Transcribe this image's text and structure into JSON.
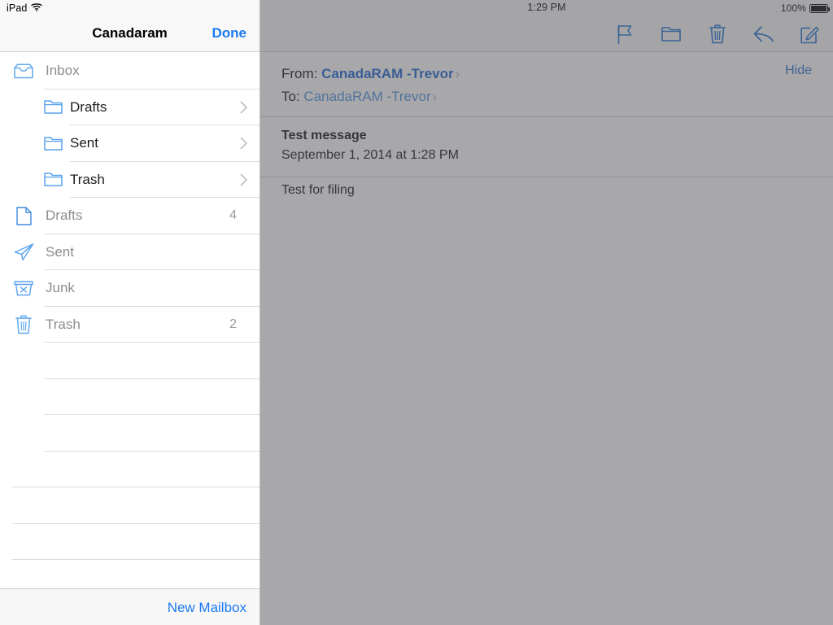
{
  "status_bar": {
    "device": "iPad",
    "wifi_icon": "wifi-icon",
    "time": "1:29 PM",
    "battery_percent": "100%",
    "battery_icon": "battery-full-icon"
  },
  "sidebar": {
    "title": "Canadaram",
    "done_label": "Done",
    "new_mailbox_label": "New Mailbox",
    "rows": [
      {
        "label": "Inbox",
        "icon": "inbox-tray-icon",
        "level": 0,
        "count": "",
        "chevron": false,
        "dim": true
      },
      {
        "label": "Drafts",
        "icon": "folder-icon",
        "level": 1,
        "count": "",
        "chevron": true,
        "dim": false
      },
      {
        "label": "Sent",
        "icon": "folder-icon",
        "level": 1,
        "count": "",
        "chevron": true,
        "dim": false
      },
      {
        "label": "Trash",
        "icon": "folder-icon",
        "level": 1,
        "count": "",
        "chevron": true,
        "dim": false
      },
      {
        "label": "Drafts",
        "icon": "document-icon",
        "level": 0,
        "count": "4",
        "chevron": false,
        "dim": true
      },
      {
        "label": "Sent",
        "icon": "paper-plane-icon",
        "level": 0,
        "count": "",
        "chevron": false,
        "dim": true
      },
      {
        "label": "Junk",
        "icon": "junk-box-icon",
        "level": 0,
        "count": "",
        "chevron": false,
        "dim": true
      },
      {
        "label": "Trash",
        "icon": "trash-can-icon",
        "level": 0,
        "count": "2",
        "chevron": false,
        "dim": true
      }
    ],
    "empty_rows": [
      {
        "style": "indent"
      },
      {
        "style": "indent"
      },
      {
        "style": "indent"
      },
      {
        "style": "indent"
      },
      {
        "style": "full"
      },
      {
        "style": "full"
      },
      {
        "style": "full"
      }
    ]
  },
  "detail": {
    "toolbar": [
      {
        "name": "flag-icon",
        "label": "Flag"
      },
      {
        "name": "folder-icon",
        "label": "Move to folder"
      },
      {
        "name": "trash-icon",
        "label": "Delete"
      },
      {
        "name": "reply-icon",
        "label": "Reply"
      },
      {
        "name": "compose-icon",
        "label": "Compose"
      }
    ],
    "message": {
      "from_label": "From:",
      "from_name": "CanadaRAM -Trevor",
      "to_label": "To:",
      "to_name": "CanadaRAM -Trevor",
      "hide_label": "Hide",
      "subject": "Test message",
      "date": "September 1, 2014 at 1:28 PM",
      "body": "Test for filing",
      "disclosure_chevron": "›"
    }
  },
  "colors": {
    "accent_blue": "#1a7aee",
    "link_blue": "#2a6bd0",
    "separator": "#dcdcdc",
    "bar_background": "#f8f8f8",
    "dim_overlay": "rgba(88,88,92,0.52)"
  }
}
